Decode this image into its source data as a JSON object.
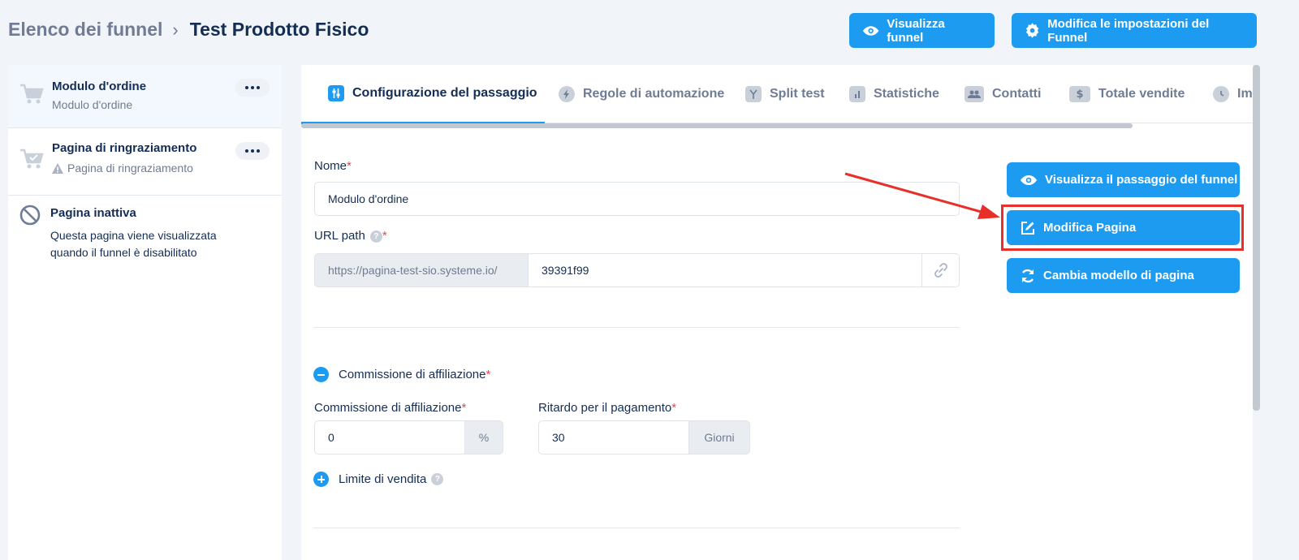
{
  "breadcrumb": {
    "root": "Elenco dei funnel",
    "current": "Test Prodotto Fisico"
  },
  "header_buttons": {
    "view_funnel": "Visualizza funnel",
    "funnel_settings": "Modifica le impostazioni del Funnel"
  },
  "sidebar": {
    "items": [
      {
        "title": "Modulo d'ordine",
        "subtitle": "Modulo d'ordine",
        "icon": "cart-icon"
      },
      {
        "title": "Pagina di ringraziamento",
        "subtitle": "Pagina di ringraziamento",
        "icon": "cart-check-icon"
      },
      {
        "title": "Pagina inattiva",
        "description": "Questa pagina viene visualizzata quando il funnel è disabilitato",
        "icon": "ban-icon"
      }
    ]
  },
  "tabs": [
    {
      "label": "Configurazione del passaggio",
      "icon": "sliders-icon",
      "active": true
    },
    {
      "label": "Regole di automazione",
      "icon": "bolt-icon"
    },
    {
      "label": "Split test",
      "icon": "split-icon"
    },
    {
      "label": "Statistiche",
      "icon": "bar-chart-icon"
    },
    {
      "label": "Contatti",
      "icon": "users-icon"
    },
    {
      "label": "Totale vendite",
      "icon": "dollar-icon"
    },
    {
      "label": "Im",
      "icon": "clock-icon"
    }
  ],
  "form": {
    "name_label": "Nome",
    "name_value": "Modulo d'ordine",
    "url_label": "URL path",
    "url_prefix": "https://pagina-test-sio.systeme.io/",
    "url_value": "39391f99",
    "affiliate_section": "Commissione di affiliazione",
    "affiliate_label": "Commissione di affiliazione",
    "affiliate_value": "0",
    "affiliate_unit": "%",
    "delay_label": "Ritardo per il pagamento",
    "delay_value": "30",
    "delay_unit": "Giorni",
    "sales_limit": "Limite di vendita",
    "required_mark": "*",
    "help_mark": "?"
  },
  "actions": {
    "view_step": "Visualizza il passaggio del funnel",
    "edit_page": "Modifica Pagina",
    "change_template": "Cambia modello di pagina"
  },
  "colors": {
    "primary": "#1d9bf0",
    "highlight": "#e8302a",
    "text": "#142d54",
    "muted": "#6f7c93"
  }
}
